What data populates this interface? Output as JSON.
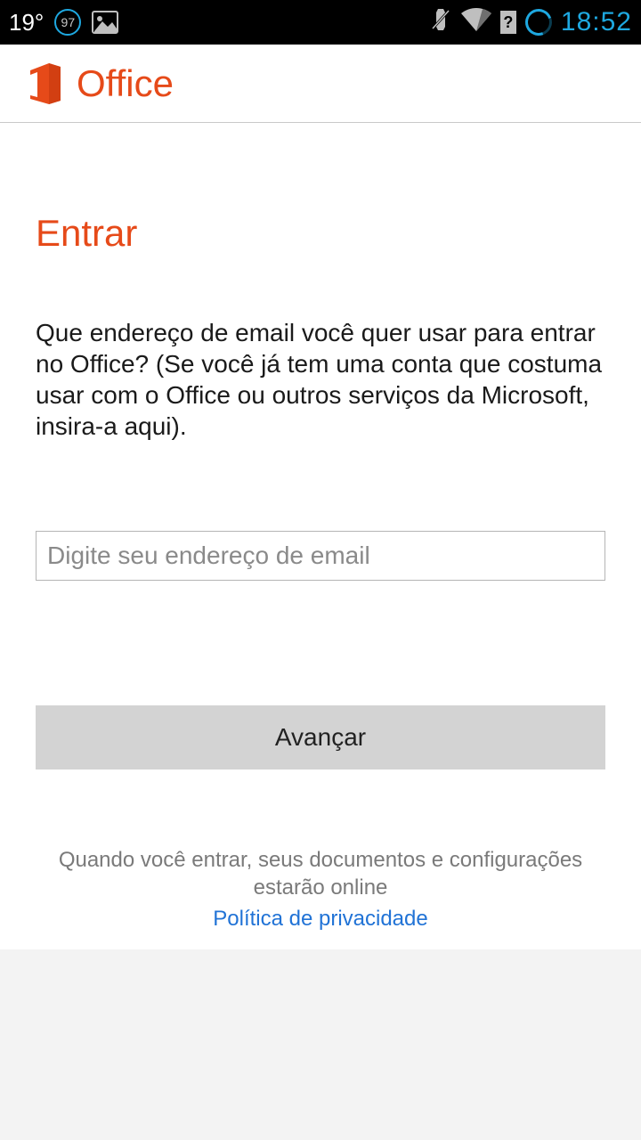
{
  "status": {
    "temperature": "19°",
    "battery_percent": "97",
    "clock": "18:52"
  },
  "header": {
    "app_name": "Office"
  },
  "signin": {
    "title": "Entrar",
    "instructions": "Que endereço de email você quer usar para entrar no Office? (Se você já tem uma conta que costuma usar com o Office ou outros serviços da Microsoft, insira-a aqui).",
    "email_placeholder": "Digite seu endereço de email",
    "email_value": "",
    "advance_label": "Avançar",
    "footer_text": "Quando você entrar, seus documentos e configurações estarão online",
    "privacy_link": "Política de privacidade"
  },
  "colors": {
    "accent": "#e64a19",
    "link": "#2173d6",
    "status_accent": "#1ea8e0"
  }
}
